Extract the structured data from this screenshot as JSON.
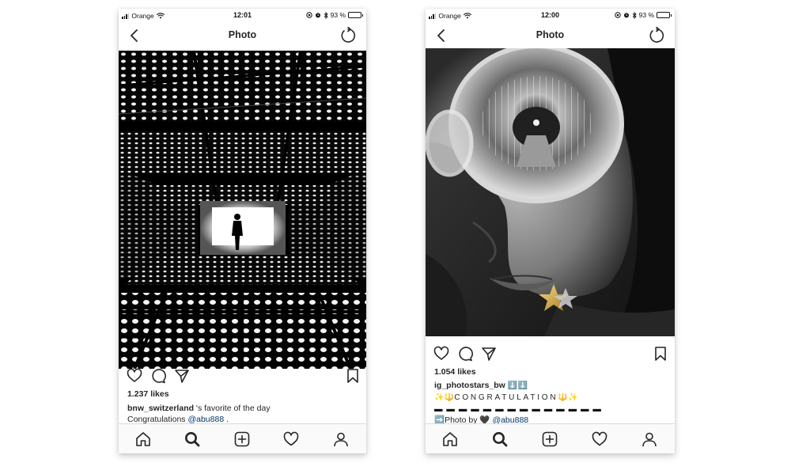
{
  "colors": {
    "text": "#262626",
    "mention": "#003569",
    "tab_bg": "#fafafa",
    "divider": "#dbdbdb"
  },
  "left": {
    "status": {
      "carrier": "Orange",
      "time": "12:01",
      "battery_text": "93 %",
      "battery_level": 0.93
    },
    "nav": {
      "title": "Photo",
      "back_icon": "chevron-left-icon",
      "refresh_icon": "refresh-icon"
    },
    "photo": {
      "subject": "black-and-white perforated ceiling hall with silhouetted figure"
    },
    "likes": "1.237 likes",
    "caption": {
      "username": "bnw_switzerland",
      "text": " 's favorite  of the day",
      "line2_prefix": "Congratulations  ",
      "mention": "@abu888",
      "line2_suffix": " ."
    },
    "tabs": [
      "home-icon",
      "search-icon",
      "add-post-icon",
      "activity-heart-icon",
      "profile-icon"
    ]
  },
  "right": {
    "status": {
      "carrier": "Orange",
      "time": "12:00",
      "battery_text": "93 %",
      "battery_level": 0.93
    },
    "nav": {
      "title": "Photo",
      "back_icon": "chevron-left-icon",
      "refresh_icon": "refresh-icon"
    },
    "photo": {
      "subject": "black-and-white portrait with round glasses reflecting an escalator tunnel"
    },
    "likes": "1.054 likes",
    "caption": {
      "username": "ig_photostars_bw",
      "username_suffix": " ⬇️⬇️",
      "congrats_prefix": "✨🔱",
      "congrats_text": "CONGRATULATION",
      "congrats_suffix": "🔱✨",
      "dashes": "▬ ▬ ▬ ▬ ▬ ▬ ▬ ▬ ▬ ▬ ▬ ▬ ▬ ▬",
      "photo_by_prefix": "➡️Photo by 🖤 ",
      "mention": "@abu888"
    },
    "tabs": [
      "home-icon",
      "search-icon",
      "add-post-icon",
      "activity-heart-icon",
      "profile-icon"
    ]
  }
}
